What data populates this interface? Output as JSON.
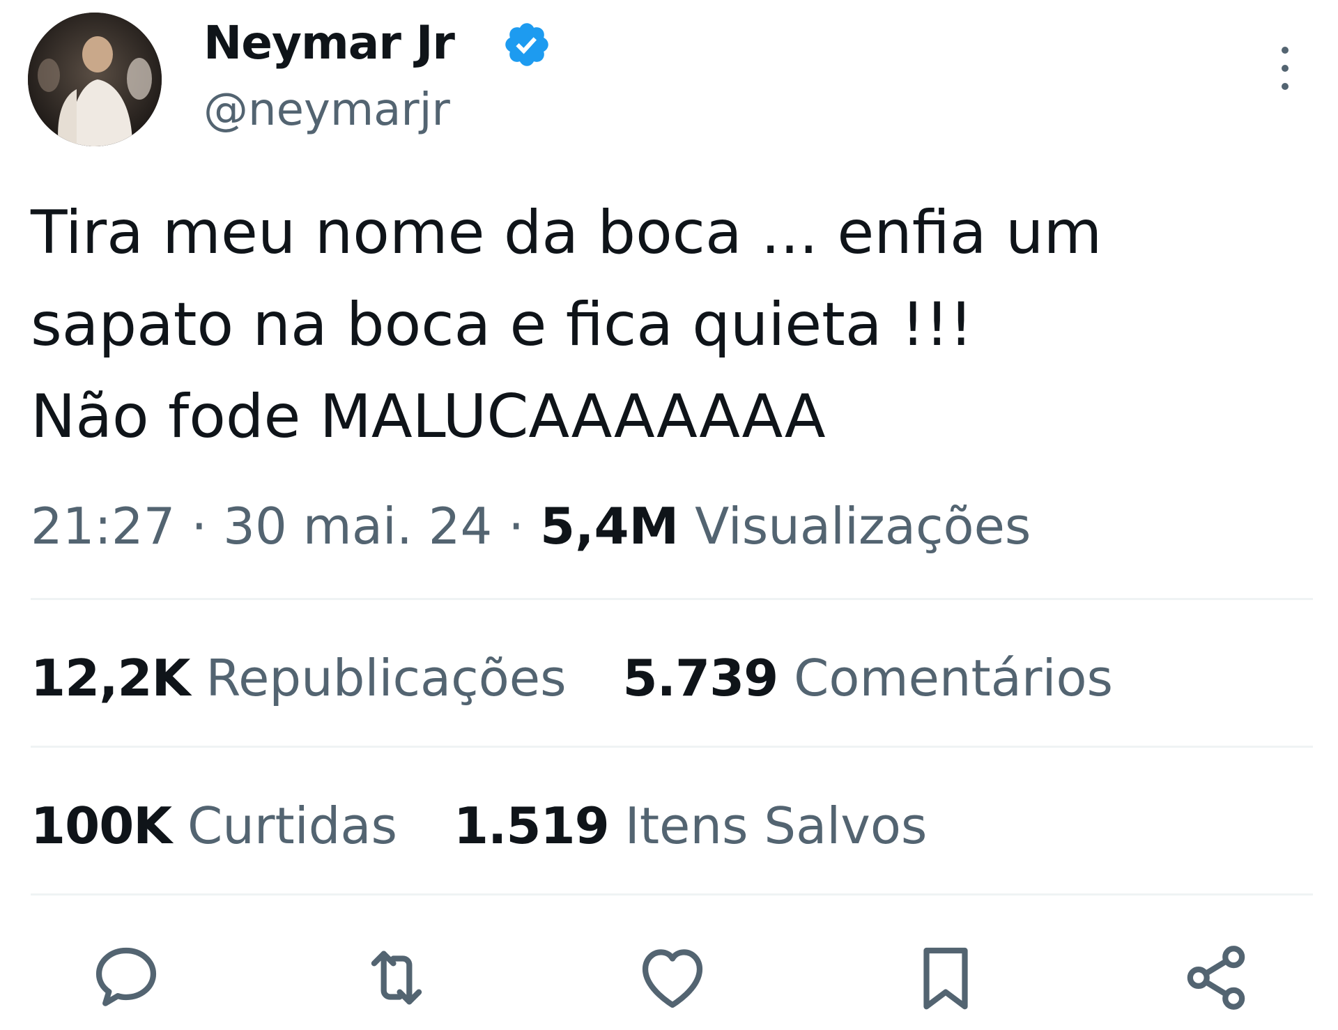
{
  "author": {
    "display_name": "Neymar Jr",
    "handle": "@neymarjr",
    "avatar_icon": "profile-photo",
    "verified_icon": "verified-badge-icon",
    "verified_color": "#1d9bf0"
  },
  "tweet": {
    "lines": [
      "Tira meu nome da boca ... enfia um",
      "sapato na boca e fica quieta !!!",
      "Não fode MALUCAAAAAAA"
    ],
    "time": "21:27",
    "separator": "·",
    "date": "30 mai. 24",
    "views_count": "5,4M",
    "views_label": "Visualizações"
  },
  "stats": {
    "reposts_count": "12,2K",
    "reposts_label": "Republicações",
    "comments_count": "5.739",
    "comments_label": "Comentários",
    "likes_count": "100K",
    "likes_label": "Curtidas",
    "saves_count": "1.519",
    "saves_label": "Itens Salvos"
  },
  "actions": [
    {
      "icon": "reply-icon"
    },
    {
      "icon": "repost-icon"
    },
    {
      "icon": "like-icon"
    },
    {
      "icon": "bookmark-icon"
    },
    {
      "icon": "share-icon"
    }
  ],
  "colors": {
    "text_primary": "#0f1419",
    "text_secondary": "#536471",
    "divider": "#eff3f4"
  }
}
